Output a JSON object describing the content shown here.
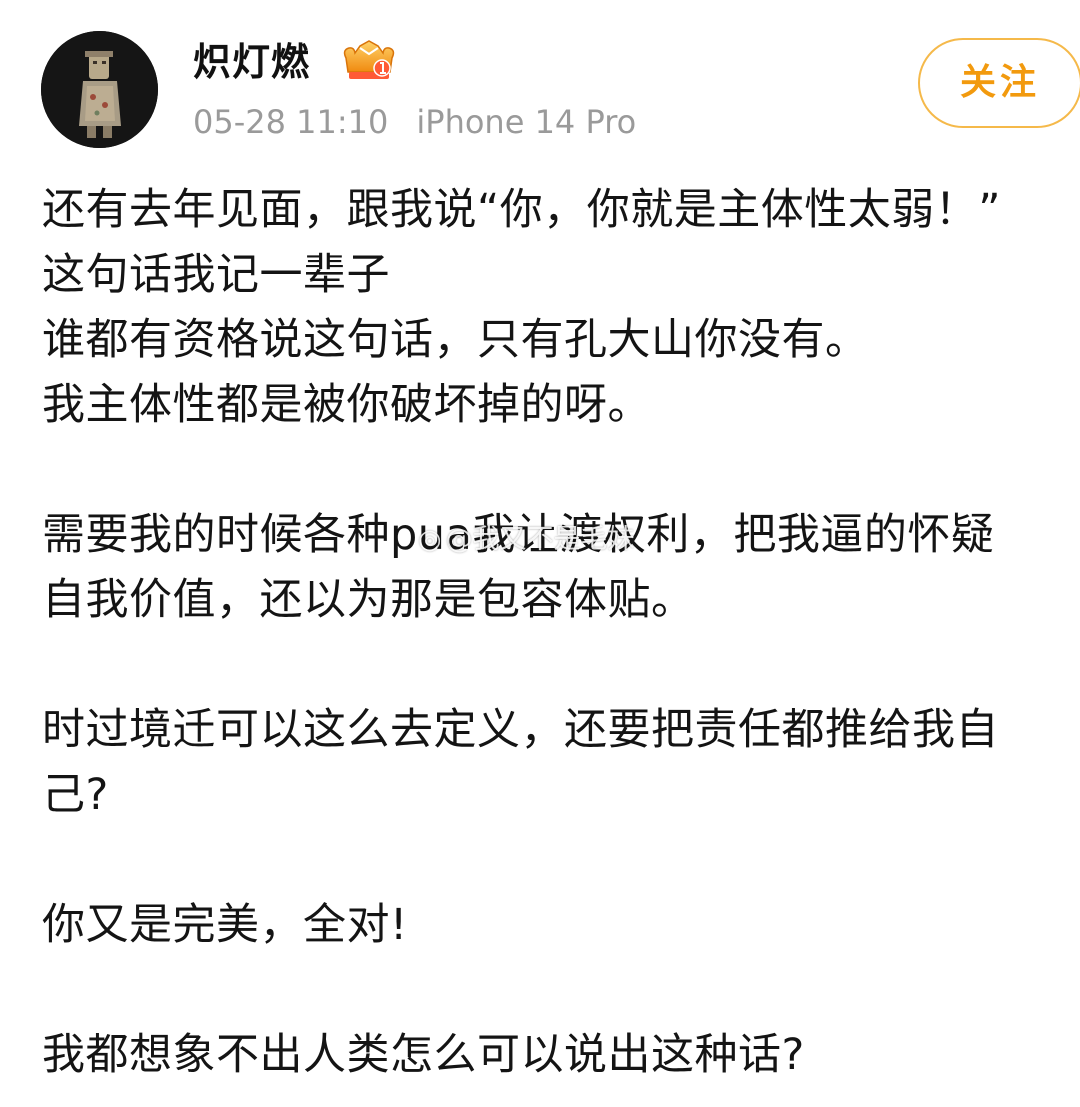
{
  "header": {
    "username": "炽灯燃",
    "timestamp": "05-28 11:10",
    "device": "iPhone 14 Pro",
    "follow_label": "关注",
    "badge_icon": "vip-crown-icon"
  },
  "post": {
    "lines": [
      "还有去年见面，跟我说“你，你就是主体性太弱！”",
      "这句话我记一辈子",
      "谁都有资格说这句话，只有孔大山你没有。",
      "我主体性都是被你破坏掉的呀。",
      "",
      "需要我的时候各种pua我让渡权利，把我逼的怀疑",
      "自我价值，还以为那是包容体贴。",
      "",
      "时过境迁可以这么去定义，还要把责任都推给我自",
      "己?",
      "",
      "你又是完美，全对!",
      "",
      "我都想象不出人类怎么可以说出这种话?"
    ]
  },
  "watermark": {
    "icon": "weibo-icon",
    "text": "@我又不是毛妹"
  },
  "colors": {
    "accent": "#f29a0e",
    "meta": "#9a9a9a",
    "text": "#141414"
  }
}
